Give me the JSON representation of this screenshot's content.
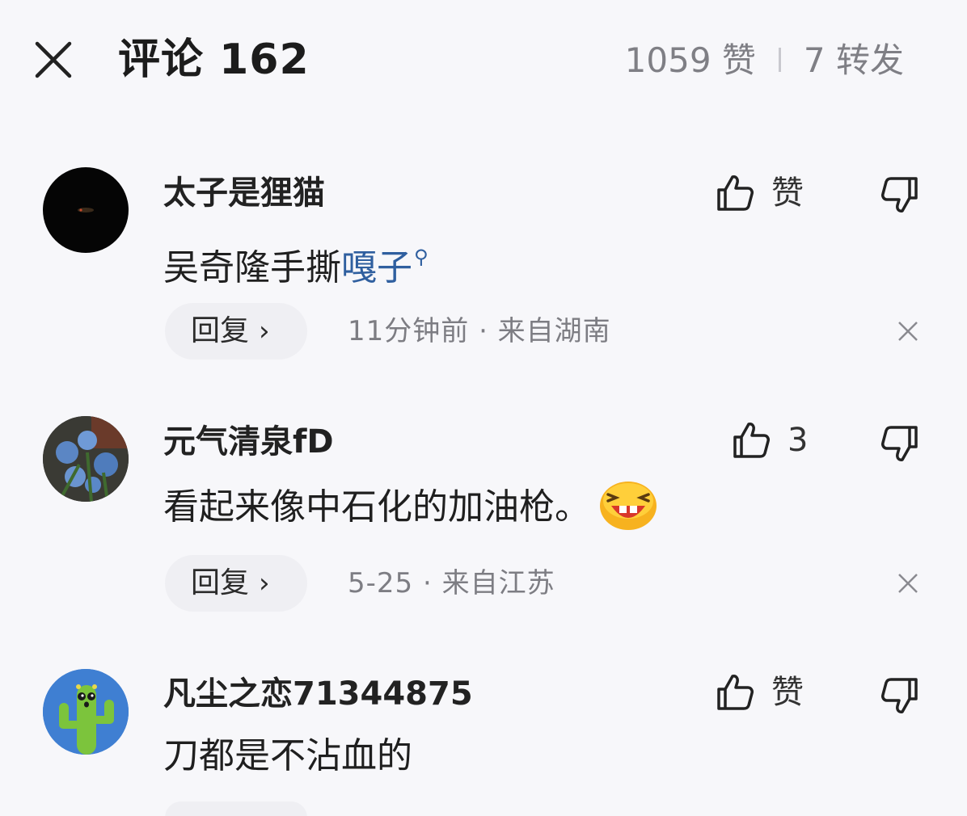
{
  "header": {
    "title": "评论 162",
    "likes": "1059 赞",
    "shares": "7 转发"
  },
  "comments": [
    {
      "username": "太子是狸猫",
      "content_text": "吴奇隆手撕",
      "content_link": "嘎子",
      "like_label": "赞",
      "reply_label": "回复",
      "meta": "11分钟前 · 来自湖南"
    },
    {
      "username": "元气清泉fD",
      "content_text": "看起来像中石化的加油枪。",
      "like_label": "3",
      "reply_label": "回复",
      "meta": "5-25 · 来自江苏"
    },
    {
      "username": "凡尘之恋71344875",
      "content_text": "刀都是不沾血的",
      "like_label": "赞"
    }
  ],
  "icons": {
    "close": "close-icon",
    "like": "thumbs-up-icon",
    "dislike": "thumbs-down-icon",
    "dismiss": "dismiss-icon",
    "search": "search-icon",
    "emoji": "laughing-emoji-icon"
  },
  "colors": {
    "background": "#f7f7fa",
    "link": "#2f5f9f",
    "muted": "#7d7d83",
    "pill": "#efeff3"
  }
}
